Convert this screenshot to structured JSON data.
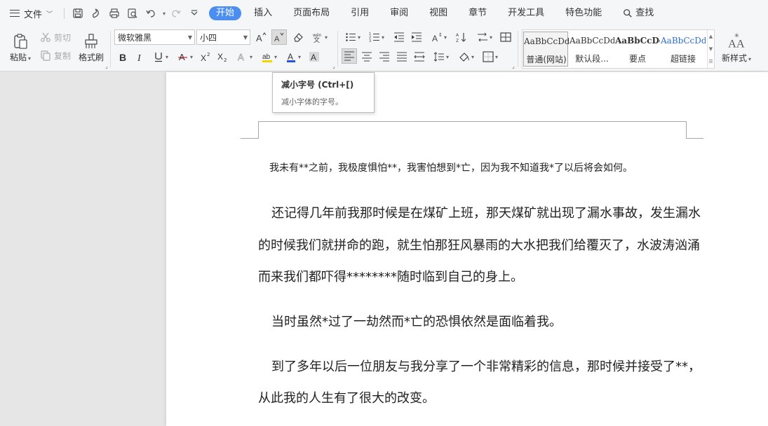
{
  "tabbar": {
    "file_label": "文件",
    "tabs": [
      "开始",
      "插入",
      "页面布局",
      "引用",
      "审阅",
      "视图",
      "章节",
      "开发工具",
      "特色功能"
    ],
    "search_label": "查找",
    "active_color": "#4a8ef2"
  },
  "ribbon": {
    "paste_label": "粘贴",
    "cut_label": "剪切",
    "copy_label": "复制",
    "format_painter_label": "格式刷",
    "font_name": "微软雅黑",
    "font_size": "小四",
    "styles": [
      {
        "sample": "AaBbCcDd",
        "name": "普通(网站)"
      },
      {
        "sample": "AaBbCcDd",
        "name": "默认段..."
      },
      {
        "sample": "AaBbCcDd",
        "name": "要点"
      },
      {
        "sample": "AaBbCcDd",
        "name": "超链接"
      }
    ],
    "new_style_label": "新样式"
  },
  "tooltip": {
    "title": "减小字号 (Ctrl+[)",
    "description": "减小字体的字号。"
  },
  "document": {
    "paragraphs": [
      "我未有**之前，我极度惧怕**，我害怕想到*亡，因为我不知道我*了以后将会如何。",
      "还记得几年前我那时候是在煤矿上班，那天煤矿就出现了漏水事故，发生漏水",
      "的时候我们就拼命的跑，就生怕那狂风暴雨的大水把我们给覆灭了，水波涛汹涌",
      "而来我们都吓得********随时临到自己的身上。",
      "当时虽然*过了一劫然而*亡的恐惧依然是面临着我。",
      "到了多年以后一位朋友与我分享了一个非常精彩的信息，那时候并接受了**，",
      "从此我的人生有了很大的改变。"
    ]
  }
}
